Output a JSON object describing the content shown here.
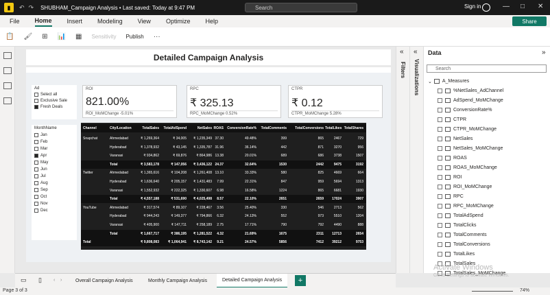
{
  "titlebar": {
    "doc_title": "SHUBHAM_Campaign Analysis • Last saved: Today at 9:47 PM",
    "search_placeholder": "Search",
    "signin": "Sign in"
  },
  "menu": [
    "File",
    "Home",
    "Insert",
    "Modeling",
    "View",
    "Optimize",
    "Help"
  ],
  "share": "Share",
  "ribbon": {
    "sensitivity": "Sensitivity",
    "publish": "Publish"
  },
  "report": {
    "title": "Detailed Campaign Analysis",
    "ad_slicer": {
      "title": "Ad",
      "items": [
        "Select all",
        "Exclusive Sale",
        "Fresh Deals"
      ]
    },
    "kpis": [
      {
        "label": "ROI",
        "value": "821.00%",
        "sub": "ROI_MoMChange -5.01%"
      },
      {
        "label": "RPC",
        "value": "₹ 325.13",
        "sub": "RPC_MoMChange 0.52%"
      },
      {
        "label": "CTPR",
        "value": "₹ 0.12",
        "sub": "CTPR_MoMChange 5.28%"
      }
    ],
    "month_slicer": {
      "title": "MonthName",
      "items": [
        "Jan",
        "Feb",
        "Mar",
        "Apr",
        "May",
        "Jun",
        "Jul",
        "Aug",
        "Sep",
        "Oct",
        "Nov",
        "Dec"
      ]
    },
    "table": {
      "headers": [
        "Channel",
        "City/Location",
        "TotalSales",
        "TotalAdSpend",
        "NetSales",
        "ROAS",
        "ConversionRate%",
        "TotalComments",
        "TotalConversions",
        "TotalLikes",
        "TotalShares"
      ],
      "rows": [
        [
          "Snapchat",
          "Ahmedabad",
          "₹ 1,269,364",
          "₹ 34,005",
          "₹ 1,235,349",
          "37.30",
          "49.48%",
          "399",
          "865",
          "2467",
          "729"
        ],
        [
          "",
          "Hyderabad",
          "₹ 1,378,932",
          "₹ 43,145",
          "₹ 1,335,787",
          "31.96",
          "36.14%",
          "442",
          "871",
          "3270",
          "956"
        ],
        [
          "",
          "Varanasi",
          "₹ 934,862",
          "₹ 69,876",
          "₹ 864,986",
          "13.38",
          "20.01%",
          "689",
          "686",
          "3738",
          "1507"
        ],
        [
          "",
          "Total",
          "₹ 3,583,178",
          "₹ 147,056",
          "₹ 3,436,122",
          "24.37",
          "32.64%",
          "1530",
          "2442",
          "9475",
          "3192"
        ],
        [
          "Twitter",
          "Ahmedabad",
          "₹ 1,365,616",
          "₹ 104,208",
          "₹ 1,261,408",
          "13.10",
          "33.33%",
          "580",
          "825",
          "4669",
          "664"
        ],
        [
          "",
          "Hyderabad",
          "₹ 1,636,640",
          "₹ 205,157",
          "₹ 1,431,483",
          "7.99",
          "22.31%",
          "847",
          "959",
          "5694",
          "1313"
        ],
        [
          "",
          "Varanasi",
          "₹ 1,552,932",
          "₹ 222,325",
          "₹ 1,330,607",
          "6.98",
          "16.58%",
          "1224",
          "865",
          "6681",
          "1930"
        ],
        [
          "",
          "Total",
          "₹ 4,557,188",
          "₹ 531,690",
          "₹ 4,025,498",
          "8.57",
          "22.10%",
          "2651",
          "2659",
          "17024",
          "3907"
        ],
        [
          "YouTube",
          "Ahmedabad",
          "₹ 317,574",
          "₹ 89,107",
          "₹ 228,467",
          "3.56",
          "25.40%",
          "330",
          "546",
          "2713",
          "562"
        ],
        [
          "",
          "Hyderabad",
          "₹ 944,243",
          "₹ 149,377",
          "₹ 794,866",
          "6.32",
          "24.13%",
          "552",
          "973",
          "5510",
          "1204"
        ],
        [
          "",
          "Varanasi",
          "₹ 405,900",
          "₹ 147,711",
          "₹ 258,189",
          "2.75",
          "17.71%",
          "790",
          "792",
          "4490",
          "888"
        ],
        [
          "",
          "Total",
          "₹ 1,667,717",
          "₹ 386,195",
          "₹ 1,281,522",
          "4.32",
          "21.69%",
          "1675",
          "2311",
          "12713",
          "2654"
        ],
        [
          "Total",
          "",
          "₹ 9,808,083",
          "₹ 1,064,941",
          "₹ 8,743,142",
          "9.21",
          "24.57%",
          "5856",
          "7412",
          "39212",
          "9753"
        ]
      ]
    }
  },
  "panes": {
    "filters": "Filters",
    "visualizations": "Visualizations",
    "data": "Data",
    "search_placeholder": "Search"
  },
  "data_fields": {
    "table_name": "A_Measures",
    "items": [
      "%NetSales_AdChannel",
      "AdSpend_MoMChange",
      "ConversionRate%",
      "CTPR",
      "CTPR_MoMChange",
      "NetSales",
      "NetSales_MoMChange",
      "ROAS",
      "ROAS_MoMChange",
      "ROI",
      "ROI_MoMChange",
      "RPC",
      "RPC_MoMChange",
      "TotalAdSpend",
      "TotalClicks",
      "TotalComments",
      "TotalConversions",
      "TotalLikes",
      "TotalSales",
      "TotalSales_MoMChange"
    ]
  },
  "page_tabs": [
    "Overall Campaign Analysis",
    "Monthly Campaign Analysis",
    "Detailed Campaign Analysis"
  ],
  "status": {
    "page": "Page 3 of 3",
    "zoom": "74%"
  },
  "watermark": {
    "line1": "Activate Windows",
    "line2": "Go to Settings to activate Windows."
  }
}
